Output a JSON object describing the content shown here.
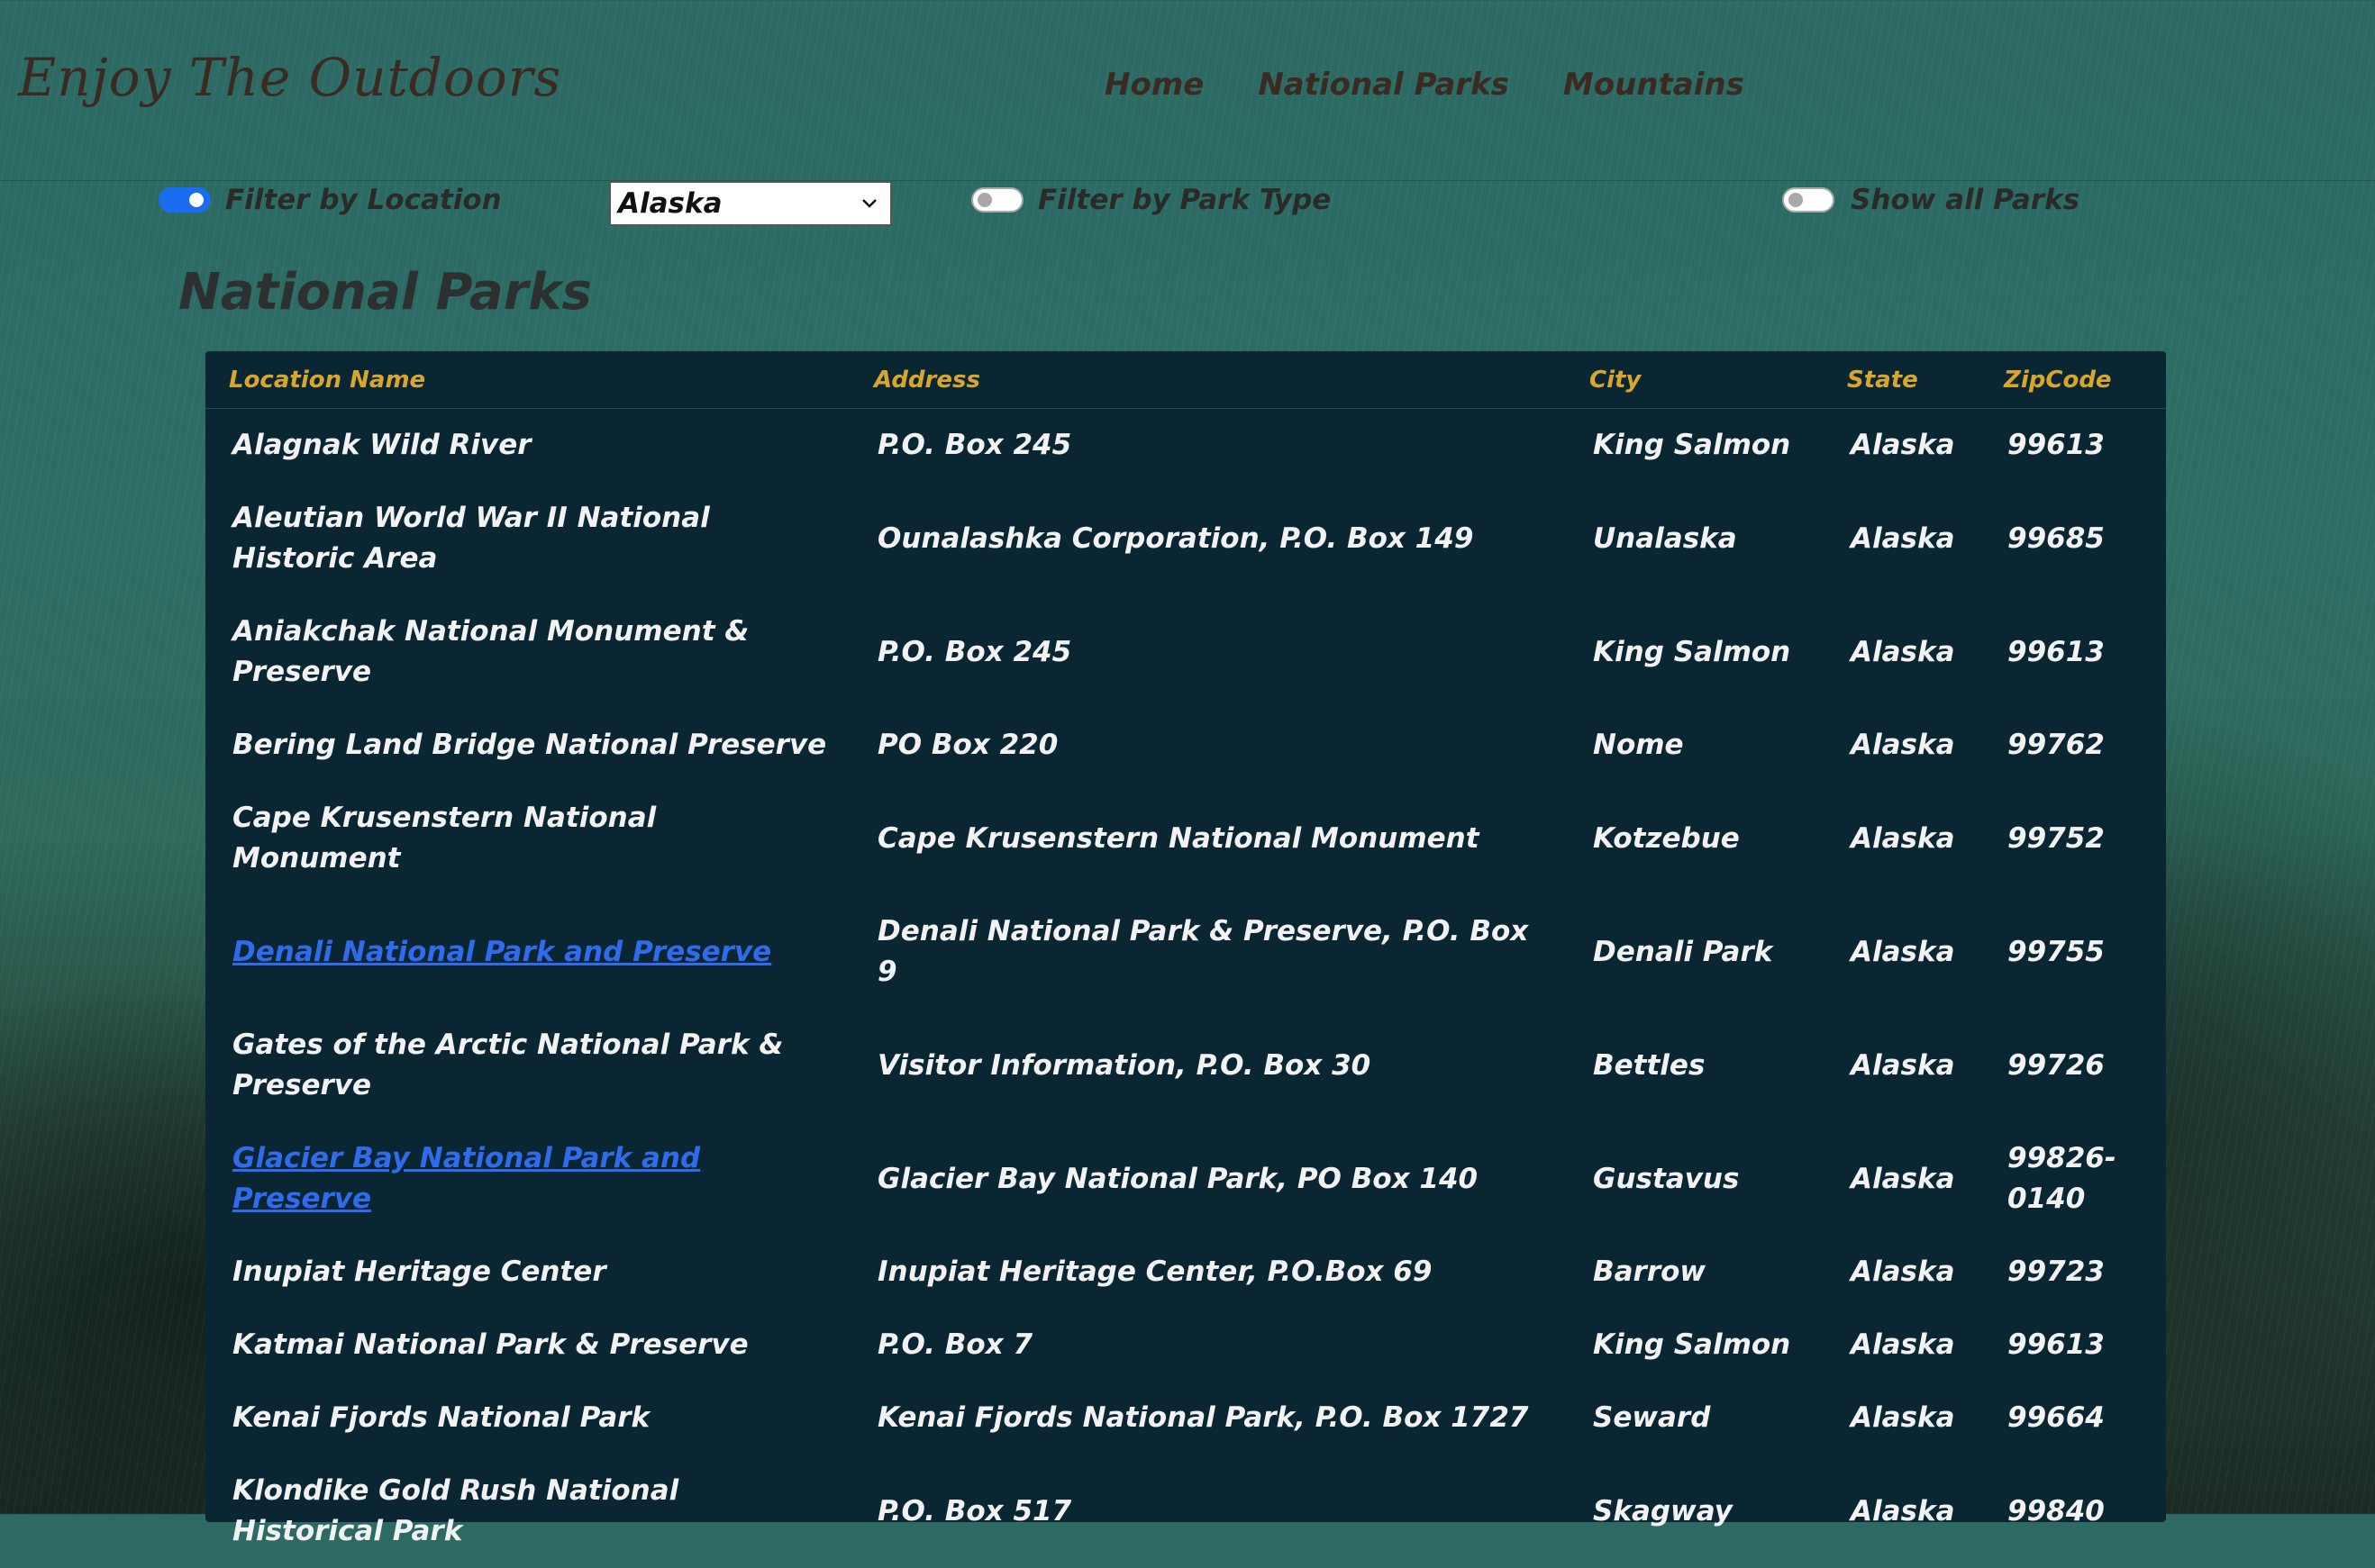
{
  "header": {
    "brand": "Enjoy The Outdoors",
    "nav": [
      "Home",
      "National Parks",
      "Mountains"
    ]
  },
  "filters": {
    "location_label": "Filter by Location",
    "location_on": true,
    "location_value": "Alaska",
    "park_type_label": "Filter by Park Type",
    "park_type_on": false,
    "show_all_label": "Show all Parks",
    "show_all_on": false
  },
  "page_title": "National Parks",
  "table": {
    "headers": [
      "Location Name",
      "Address",
      "City",
      "State",
      "ZipCode"
    ],
    "rows": [
      {
        "name": "Alagnak Wild River",
        "link": false,
        "address": "P.O. Box 245",
        "city": "King Salmon",
        "state": "Alaska",
        "zip": "99613"
      },
      {
        "name": "Aleutian World War II National Historic Area",
        "link": false,
        "address": "Ounalashka Corporation, P.O. Box 149",
        "city": "Unalaska",
        "state": "Alaska",
        "zip": "99685"
      },
      {
        "name": "Aniakchak National Monument & Preserve",
        "link": false,
        "address": "P.O. Box 245",
        "city": "King Salmon",
        "state": "Alaska",
        "zip": "99613"
      },
      {
        "name": "Bering Land Bridge National Preserve",
        "link": false,
        "address": "PO Box 220",
        "city": "Nome",
        "state": "Alaska",
        "zip": "99762"
      },
      {
        "name": "Cape Krusenstern National Monument",
        "link": false,
        "address": "Cape Krusenstern National Monument",
        "city": "Kotzebue",
        "state": "Alaska",
        "zip": "99752"
      },
      {
        "name": "Denali National Park and Preserve",
        "link": true,
        "address": "Denali National Park & Preserve, P.O. Box 9",
        "city": "Denali Park",
        "state": "Alaska",
        "zip": "99755"
      },
      {
        "name": "Gates of the Arctic National Park & Preserve",
        "link": false,
        "address": "Visitor Information, P.O. Box 30",
        "city": "Bettles",
        "state": "Alaska",
        "zip": "99726"
      },
      {
        "name": "Glacier Bay National Park and Preserve",
        "link": true,
        "address": "Glacier Bay National Park, PO Box 140",
        "city": "Gustavus",
        "state": "Alaska",
        "zip": "99826-0140"
      },
      {
        "name": "Inupiat Heritage Center",
        "link": false,
        "address": "Inupiat Heritage Center, P.O.Box 69",
        "city": "Barrow",
        "state": "Alaska",
        "zip": "99723"
      },
      {
        "name": "Katmai National Park & Preserve",
        "link": false,
        "address": "P.O. Box 7",
        "city": "King Salmon",
        "state": "Alaska",
        "zip": "99613"
      },
      {
        "name": "Kenai Fjords National Park",
        "link": false,
        "address": "Kenai Fjords National Park, P.O. Box 1727",
        "city": "Seward",
        "state": "Alaska",
        "zip": "99664"
      },
      {
        "name": "Klondike Gold Rush National Historical Park",
        "link": false,
        "address": "P.O. Box 517",
        "city": "Skagway",
        "state": "Alaska",
        "zip": "99840"
      }
    ]
  },
  "colors": {
    "header_text": "#d9a62d",
    "link": "#2f6bea",
    "table_bg": "#0a2633",
    "toggle_on": "#1a6cf0"
  }
}
